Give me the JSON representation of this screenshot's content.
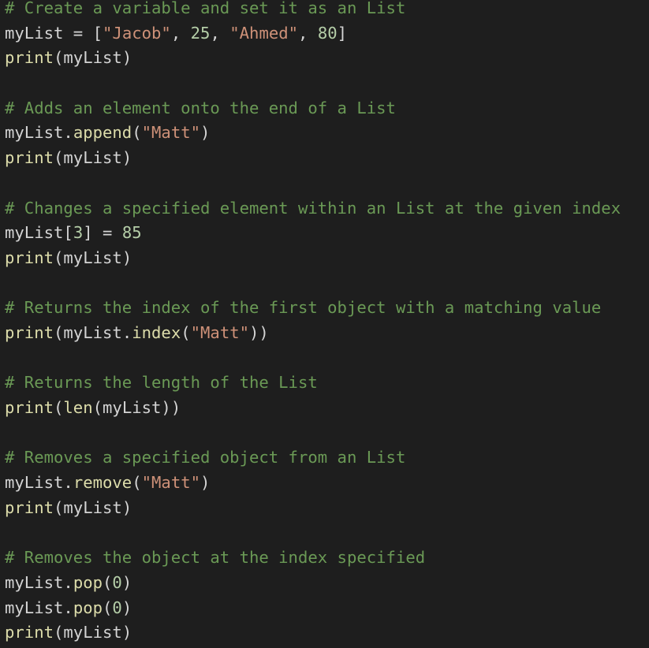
{
  "editor": {
    "language": "python",
    "theme": {
      "background": "#1e1e1e",
      "default": "#d4d4d4",
      "comment": "#6a9955",
      "function": "#dcdcaa",
      "string": "#ce9178",
      "number": "#b5cea8"
    },
    "lines": [
      {
        "tokens": [
          {
            "t": "cm",
            "v": "# Create a variable and set it as an List"
          }
        ]
      },
      {
        "tokens": [
          {
            "t": "va",
            "v": "myList"
          },
          {
            "t": "pu",
            "v": " = ["
          },
          {
            "t": "st",
            "v": "\"Jacob\""
          },
          {
            "t": "pu",
            "v": ", "
          },
          {
            "t": "nu",
            "v": "25"
          },
          {
            "t": "pu",
            "v": ", "
          },
          {
            "t": "st",
            "v": "\"Ahmed\""
          },
          {
            "t": "pu",
            "v": ", "
          },
          {
            "t": "nu",
            "v": "80"
          },
          {
            "t": "pu",
            "v": "]"
          }
        ]
      },
      {
        "tokens": [
          {
            "t": "fn",
            "v": "print"
          },
          {
            "t": "pu",
            "v": "("
          },
          {
            "t": "va",
            "v": "myList"
          },
          {
            "t": "pu",
            "v": ")"
          }
        ]
      },
      {
        "tokens": []
      },
      {
        "tokens": [
          {
            "t": "cm",
            "v": "# Adds an element onto the end of a List"
          }
        ]
      },
      {
        "tokens": [
          {
            "t": "va",
            "v": "myList"
          },
          {
            "t": "pu",
            "v": "."
          },
          {
            "t": "fn",
            "v": "append"
          },
          {
            "t": "pu",
            "v": "("
          },
          {
            "t": "st",
            "v": "\"Matt\""
          },
          {
            "t": "pu",
            "v": ")"
          }
        ]
      },
      {
        "tokens": [
          {
            "t": "fn",
            "v": "print"
          },
          {
            "t": "pu",
            "v": "("
          },
          {
            "t": "va",
            "v": "myList"
          },
          {
            "t": "pu",
            "v": ")"
          }
        ]
      },
      {
        "tokens": []
      },
      {
        "tokens": [
          {
            "t": "cm",
            "v": "# Changes a specified element within an List at the given index"
          }
        ]
      },
      {
        "tokens": [
          {
            "t": "va",
            "v": "myList"
          },
          {
            "t": "pu",
            "v": "["
          },
          {
            "t": "nu",
            "v": "3"
          },
          {
            "t": "pu",
            "v": "] = "
          },
          {
            "t": "nu",
            "v": "85"
          }
        ]
      },
      {
        "tokens": [
          {
            "t": "fn",
            "v": "print"
          },
          {
            "t": "pu",
            "v": "("
          },
          {
            "t": "va",
            "v": "myList"
          },
          {
            "t": "pu",
            "v": ")"
          }
        ]
      },
      {
        "tokens": []
      },
      {
        "tokens": [
          {
            "t": "cm",
            "v": "# Returns the index of the first object with a matching value"
          }
        ]
      },
      {
        "tokens": [
          {
            "t": "fn",
            "v": "print"
          },
          {
            "t": "pu",
            "v": "("
          },
          {
            "t": "va",
            "v": "myList"
          },
          {
            "t": "pu",
            "v": "."
          },
          {
            "t": "fn",
            "v": "index"
          },
          {
            "t": "pu",
            "v": "("
          },
          {
            "t": "st",
            "v": "\"Matt\""
          },
          {
            "t": "pu",
            "v": "))"
          }
        ]
      },
      {
        "tokens": []
      },
      {
        "tokens": [
          {
            "t": "cm",
            "v": "# Returns the length of the List"
          }
        ]
      },
      {
        "tokens": [
          {
            "t": "fn",
            "v": "print"
          },
          {
            "t": "pu",
            "v": "("
          },
          {
            "t": "fn",
            "v": "len"
          },
          {
            "t": "pu",
            "v": "("
          },
          {
            "t": "va",
            "v": "myList"
          },
          {
            "t": "pu",
            "v": "))"
          }
        ]
      },
      {
        "tokens": []
      },
      {
        "tokens": [
          {
            "t": "cm",
            "v": "# Removes a specified object from an List"
          }
        ]
      },
      {
        "tokens": [
          {
            "t": "va",
            "v": "myList"
          },
          {
            "t": "pu",
            "v": "."
          },
          {
            "t": "fn",
            "v": "remove"
          },
          {
            "t": "pu",
            "v": "("
          },
          {
            "t": "st",
            "v": "\"Matt\""
          },
          {
            "t": "pu",
            "v": ")"
          }
        ]
      },
      {
        "tokens": [
          {
            "t": "fn",
            "v": "print"
          },
          {
            "t": "pu",
            "v": "("
          },
          {
            "t": "va",
            "v": "myList"
          },
          {
            "t": "pu",
            "v": ")"
          }
        ]
      },
      {
        "tokens": []
      },
      {
        "tokens": [
          {
            "t": "cm",
            "v": "# Removes the object at the index specified"
          }
        ]
      },
      {
        "tokens": [
          {
            "t": "va",
            "v": "myList"
          },
          {
            "t": "pu",
            "v": "."
          },
          {
            "t": "fn",
            "v": "pop"
          },
          {
            "t": "pu",
            "v": "("
          },
          {
            "t": "nu",
            "v": "0"
          },
          {
            "t": "pu",
            "v": ")"
          }
        ]
      },
      {
        "tokens": [
          {
            "t": "va",
            "v": "myList"
          },
          {
            "t": "pu",
            "v": "."
          },
          {
            "t": "fn",
            "v": "pop"
          },
          {
            "t": "pu",
            "v": "("
          },
          {
            "t": "nu",
            "v": "0"
          },
          {
            "t": "pu",
            "v": ")"
          }
        ]
      },
      {
        "tokens": [
          {
            "t": "fn",
            "v": "print"
          },
          {
            "t": "pu",
            "v": "("
          },
          {
            "t": "va",
            "v": "myList"
          },
          {
            "t": "pu",
            "v": ")"
          }
        ]
      }
    ]
  }
}
